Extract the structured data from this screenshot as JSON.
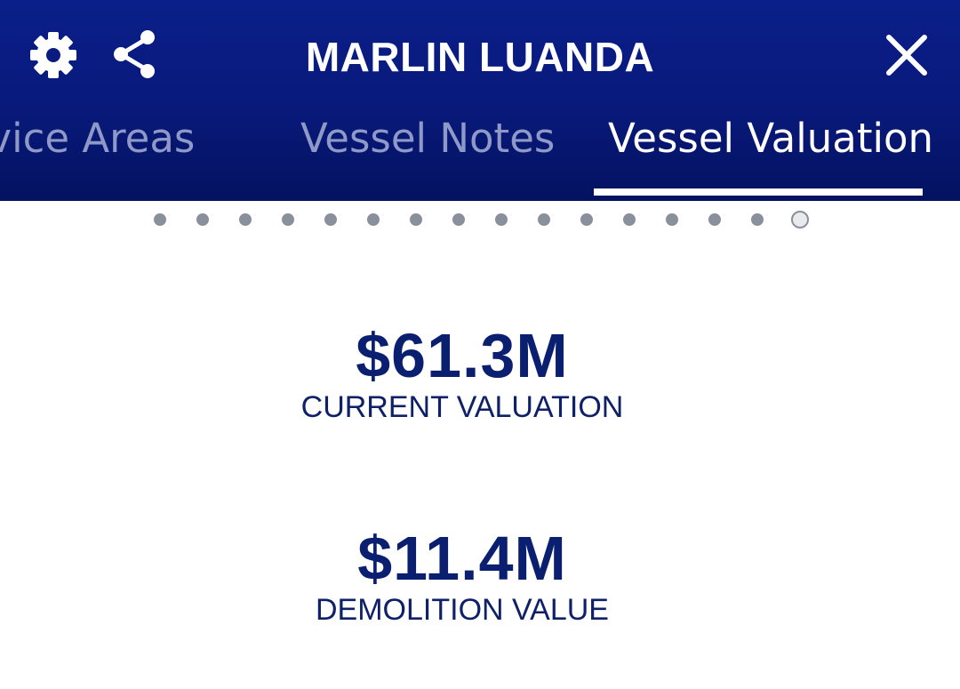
{
  "header": {
    "title": "MARLIN LUANDA",
    "icons": {
      "settings": "gear-icon",
      "share": "share-icon",
      "close": "close-icon"
    },
    "background_color": "#08197a"
  },
  "tabs": [
    {
      "label": "Service Areas",
      "visible_text": "rvice Areas",
      "active": false
    },
    {
      "label": "Vessel Notes",
      "visible_text": "Vessel Notes",
      "active": false
    },
    {
      "label": "Vessel Valuation",
      "visible_text": "Vessel Valuation",
      "active": true
    }
  ],
  "pager": {
    "total_pages": 16,
    "current_page": 16
  },
  "metrics": [
    {
      "value": "$61.3M",
      "label": "CURRENT VALUATION"
    },
    {
      "value": "$11.4M",
      "label": "DEMOLITION VALUE"
    }
  ],
  "colors": {
    "accent": "#0a1f70",
    "tab_inactive": "#8e99c7",
    "dot": "#8a8f9c"
  }
}
